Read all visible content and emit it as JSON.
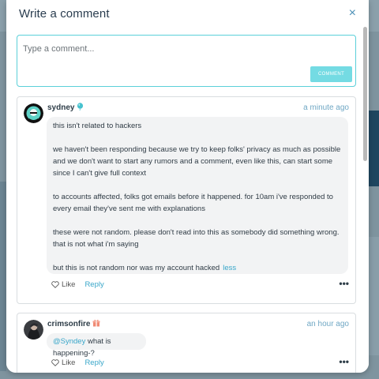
{
  "modal": {
    "title": "Write a comment",
    "close_label": "×"
  },
  "composer": {
    "placeholder": "Type a comment...",
    "button_label": "COMMENT"
  },
  "comments": [
    {
      "user": "sydney",
      "badge_icon": "balloon-icon",
      "time": "a minute ago",
      "paragraphs": [
        "this isn't related to hackers",
        "we haven't been responding because we try to keep folks' privacy as much as possible and we don't want to start any rumors and a comment, even like this, can start some since I can't give full context",
        "to accounts affected, folks got emails before it happened. for 10am i've responded to every email they've sent me with explanations",
        "these were not random. please don't read into this as somebody did something wrong. that is not what i'm saying",
        "but this is not random nor was my account hacked"
      ],
      "less_label": "less",
      "like_label": "Like",
      "reply_label": "Reply",
      "more_label": "•••"
    },
    {
      "user": "crimsonfire",
      "badge_icon": "gift-icon",
      "time": "an hour ago",
      "mention": "@Syndey",
      "text": "what is happening-?",
      "like_label": "Like",
      "reply_label": "Reply",
      "more_label": "•••"
    }
  ],
  "colors": {
    "accent": "#38a6c9",
    "border_focus": "#5bd0d9",
    "button": "#74dbe3"
  }
}
